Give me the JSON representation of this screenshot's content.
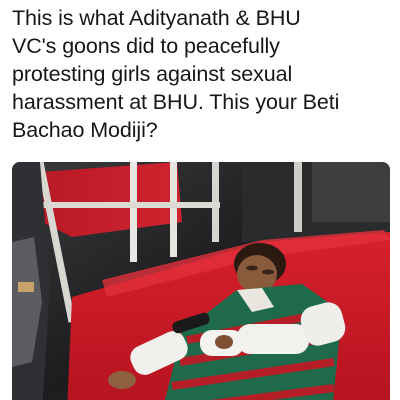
{
  "tweet": {
    "text": "This is what Adityanath & BHU\nVC's goons did to peacefully\nprotesting girls against sexual\nharassment at BHU. This your Beti\nBachao Modiji?"
  },
  "media": {
    "type": "photo"
  }
}
